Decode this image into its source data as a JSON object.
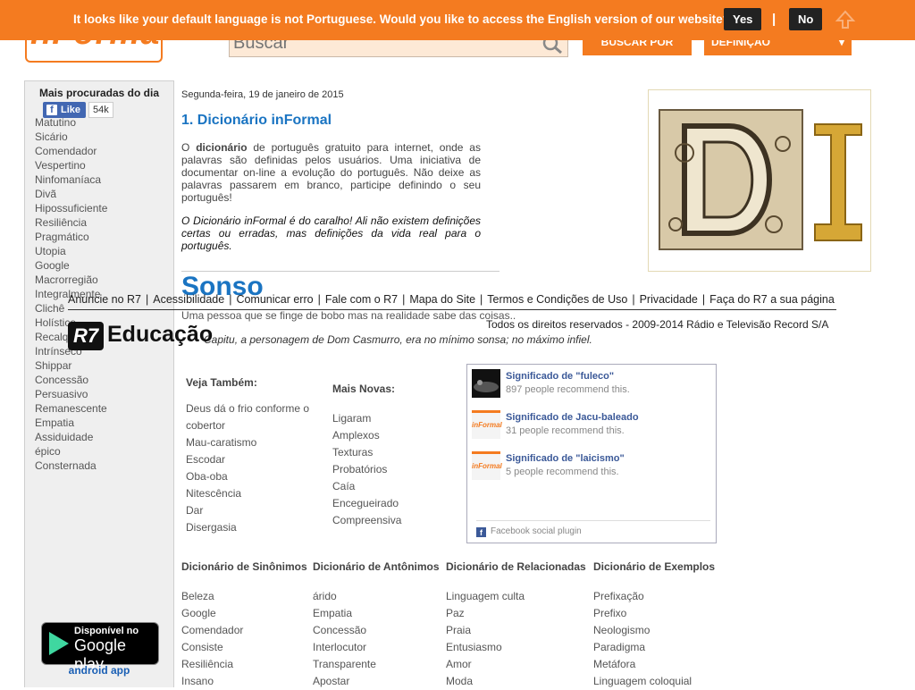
{
  "header": {
    "logo_text": "nFormal",
    "search_placeholder": "Buscar",
    "buscar_por_label": "BUSCAR POR",
    "select_label": "DEFINIÇÃO"
  },
  "langbar": {
    "message": "It looks like your default language is not Portuguese. Would you like to access the English version of our website?",
    "yes": "Yes",
    "separator": "|",
    "no": "No"
  },
  "sidebar": {
    "title": "Mais procuradas do dia",
    "like_label": "Like",
    "like_count": "54k",
    "items": [
      "Matutino",
      "Sicário",
      "Comendador",
      "Vespertino",
      "Ninfomaníaca",
      "Divã",
      "Hipossuficiente",
      "Resiliência",
      "Pragmático",
      "Utopia",
      "Google",
      "Macrorregião",
      "Integralmente",
      "Clichê",
      "Holístico",
      "Recalque",
      "Intrínseco",
      "Shippar",
      "Concessão",
      "Persuasivo",
      "Remanescente",
      "Empatia",
      "Assiduidade",
      "épico",
      "Consternada"
    ],
    "gplay_line1": "Disponível no",
    "gplay_line2": "Google play",
    "android_app": "android app"
  },
  "main": {
    "date": "Segunda-feira, 19 de janeiro de 2015",
    "intro_title": "1. Dicionário inFormal",
    "intro_p1_pre": "O ",
    "intro_p1_bold": "dicionário",
    "intro_p1_post": " de português gratuito para internet, onde as palavras são definidas pelos usuários. Uma iniciativa de documentar on-line a evolução do português. Não deixe as palavras passarem em branco, participe definindo o seu português!",
    "intro_p2": "O Dicionário inFormal é do caralho! Ali não existem definições certas ou erradas, mas definições da vida real para o português.",
    "word": "Sonso",
    "definition": "Uma pessoa que se finge de bobo mas na realidade sabe das coisas..",
    "example": "Capitu, a personagem de Dom Casmurro, era no mínimo sonsa; no máximo infiel."
  },
  "r7": {
    "links": [
      "Anuncie no R7",
      "Acessibilidade",
      "Comunicar erro",
      "Fale com o R7",
      "Mapa do Site",
      "Termos e Condições de Uso",
      "Privacidade",
      "Faça do R7 a sua página"
    ],
    "rights": "Todos os direitos reservados - 2009-2014 Rádio e Televisão Record S/A",
    "logo_box": "R7",
    "logo_text": "Educação"
  },
  "veja": {
    "title": "Veja Também:",
    "items": [
      "Deus dá o frio conforme o cobertor",
      "Mau-caratismo",
      "Escodar",
      "Oba-oba",
      "Nitescência",
      "Dar",
      "Disergasia"
    ]
  },
  "novas": {
    "title": "Mais Novas:",
    "items": [
      "Ligaram",
      "Amplexos",
      "Texturas",
      "Probatórios",
      "Caía",
      "Encegueirado",
      "Compreensiva"
    ]
  },
  "fb_plugin": {
    "items": [
      {
        "title": "Significado de \"fuleco\"",
        "sub": "897 people recommend this."
      },
      {
        "title": "Significado de Jacu-baleado",
        "sub": "31 people recommend this."
      },
      {
        "title": "Significado de \"laicismo\"",
        "sub": "5 people recommend this."
      }
    ],
    "thumb_label": "inFormal",
    "footer": "Facebook social plugin"
  },
  "columns": [
    {
      "title": "Dicionário de Sinônimos",
      "items": [
        "Beleza",
        "Google",
        "Comendador",
        "Consiste",
        "Resiliência",
        "Insano"
      ]
    },
    {
      "title": "Dicionário de Antônimos",
      "items": [
        "árido",
        "Empatia",
        "Concessão",
        "Interlocutor",
        "Transparente",
        "Apostar"
      ]
    },
    {
      "title": "Dicionário de Relacionadas",
      "items": [
        "Linguagem culta",
        "Paz",
        "Praia",
        "Entusiasmo",
        "Amor",
        "Moda"
      ]
    },
    {
      "title": "Dicionário de Exemplos",
      "items": [
        "Prefixação",
        "Prefixo",
        "Neologismo",
        "Paradigma",
        "Metáfora",
        "Linguagem coloquial"
      ]
    }
  ],
  "colors": {
    "orange": "#f47b20",
    "blue": "#1a74c2",
    "fb": "#3b5998"
  }
}
